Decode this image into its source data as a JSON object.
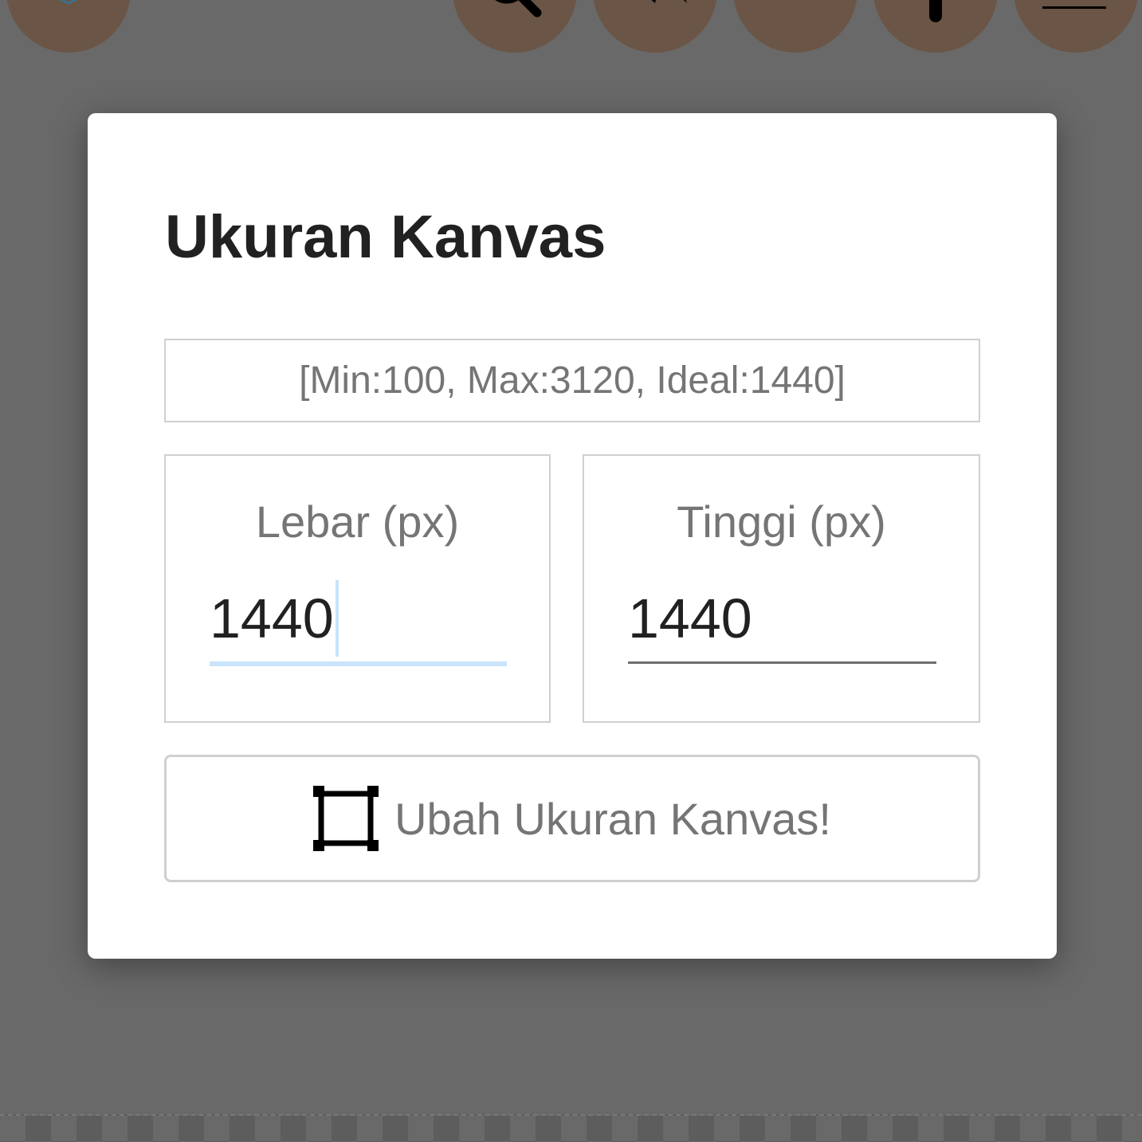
{
  "toolbar": {
    "buttons": [
      {
        "icon": "layers-icon"
      },
      {
        "icon": "search-icon"
      },
      {
        "icon": "undo-icon"
      },
      {
        "icon": "redo-icon"
      },
      {
        "icon": "add-icon"
      },
      {
        "icon": "menu-icon"
      }
    ],
    "button_color": "#6b5546"
  },
  "dialog": {
    "title": "Ukuran Kanvas",
    "hint": "[Min:100, Max:3120, Ideal:1440]",
    "width_field": {
      "label": "Lebar (px)",
      "value": "1440",
      "focused": true
    },
    "height_field": {
      "label": "Tinggi (px)",
      "value": "1440",
      "focused": false
    },
    "resize_button": {
      "label": "Ubah Ukuran Kanvas!",
      "icon": "resize-frame-icon"
    }
  },
  "colors": {
    "overlay": "#696969",
    "dialog_bg": "#ffffff",
    "focus_underline": "#c9e4fb",
    "title_text": "#212121",
    "muted_text": "#757575"
  }
}
